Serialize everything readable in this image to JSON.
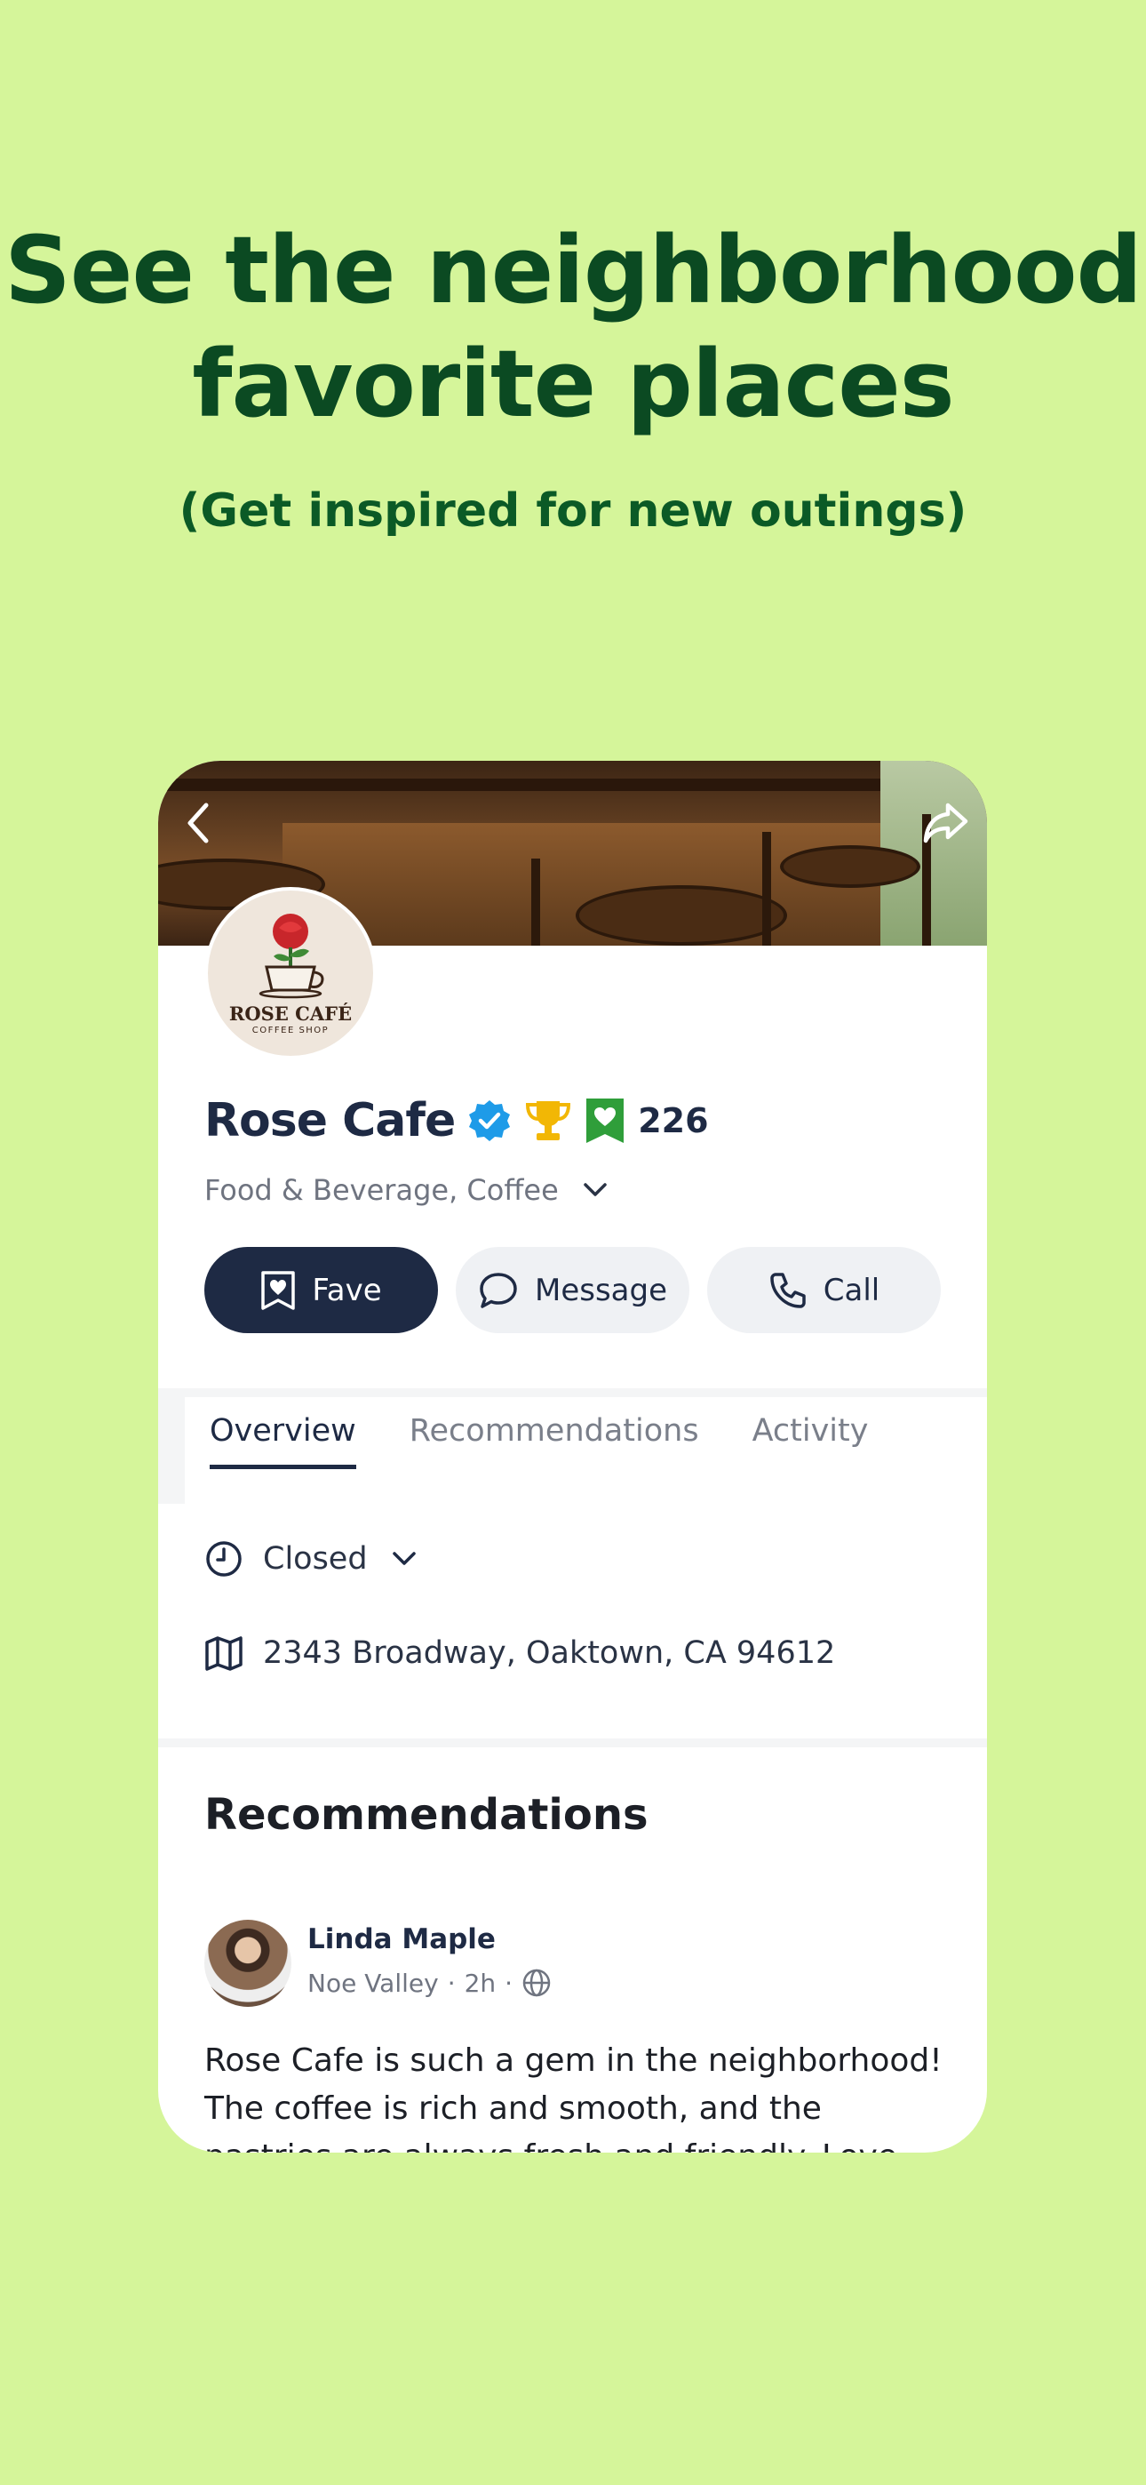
{
  "promo": {
    "headline_line1": "See the neighborhood",
    "headline_line2": "favorite places",
    "subhead": "(Get inspired for new outings)"
  },
  "colors": {
    "background": "#d5f59a",
    "headline": "#0b4a22",
    "primary_button": "#1e2a44",
    "verified_badge": "#1e9be8",
    "trophy_badge": "#f2b705",
    "fave_badge": "#2f9e3a"
  },
  "business": {
    "logo_title": "ROSE CAFÉ",
    "logo_subtitle": "COFFEE SHOP",
    "name": "Rose Cafe",
    "fave_count": "226",
    "categories": "Food & Beverage, Coffee"
  },
  "actions": {
    "fave_label": "Fave",
    "message_label": "Message",
    "call_label": "Call"
  },
  "tabs": [
    {
      "label": "Overview",
      "active": true
    },
    {
      "label": "Recommendations",
      "active": false
    },
    {
      "label": "Activity",
      "active": false
    }
  ],
  "overview": {
    "hours_status": "Closed",
    "address": "2343 Broadway, Oaktown, CA 94612"
  },
  "recommendations": {
    "heading": "Recommendations",
    "post": {
      "author": "Linda Maple",
      "neighborhood": "Noe Valley",
      "time_ago": "2h",
      "text": "Rose Cafe is such a gem in the neighborhood! The coffee is rich and smooth, and the pastries are always fresh and friendly. Love for the l"
    }
  },
  "icons": {
    "back": "chevron-left-icon",
    "share": "share-icon",
    "verified": "verified-check-icon",
    "trophy": "trophy-icon",
    "fave": "heart-bookmark-icon",
    "clock": "clock-icon",
    "map": "map-icon",
    "globe": "globe-icon"
  }
}
